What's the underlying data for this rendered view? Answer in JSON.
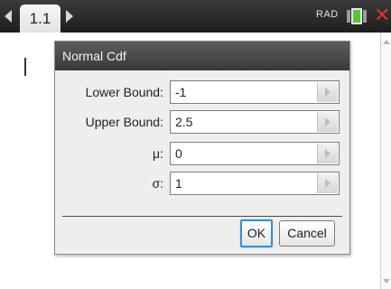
{
  "topbar": {
    "tab_label": "1.1",
    "angle_mode": "RAD",
    "icons": {
      "prev": "left-arrow-icon",
      "next": "right-arrow-icon",
      "battery": "battery-icon",
      "close": "close-icon"
    }
  },
  "dialog": {
    "title": "Normal Cdf",
    "fields": [
      {
        "label": "Lower Bound:",
        "value": "-1"
      },
      {
        "label": "Upper Bound:",
        "value": "2.5"
      },
      {
        "label": "μ:",
        "value": "0"
      },
      {
        "label": "σ:",
        "value": "1"
      }
    ],
    "ok_label": "OK",
    "cancel_label": "Cancel"
  },
  "colors": {
    "topbar": "#2b2b2b",
    "title_bar": "#4a4a4a",
    "focus_blue": "#3a8fd0",
    "close_red": "#e0322b",
    "battery_green": "#5cc23a"
  }
}
